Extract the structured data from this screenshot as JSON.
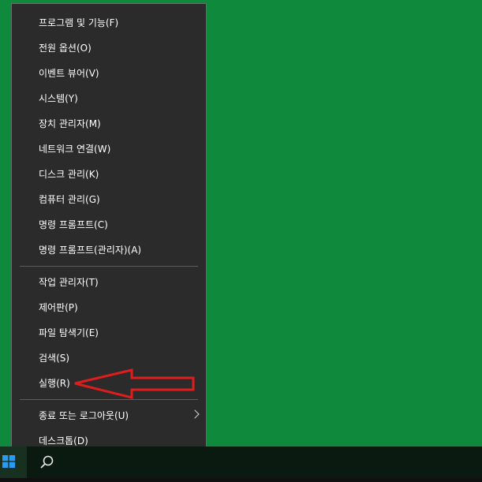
{
  "menu": {
    "items": [
      {
        "label": "프로그램 및 기능(F)"
      },
      {
        "label": "전원 옵션(O)"
      },
      {
        "label": "이벤트 뷰어(V)"
      },
      {
        "label": "시스템(Y)"
      },
      {
        "label": "장치 관리자(M)"
      },
      {
        "label": "네트워크 연결(W)"
      },
      {
        "label": "디스크 관리(K)"
      },
      {
        "label": "컴퓨터 관리(G)"
      },
      {
        "label": "명령 프롬프트(C)"
      },
      {
        "label": "명령 프롬프트(관리자)(A)"
      },
      {
        "label": "작업 관리자(T)"
      },
      {
        "label": "제어판(P)"
      },
      {
        "label": "파일 탐색기(E)"
      },
      {
        "label": "검색(S)"
      },
      {
        "label": "실행(R)"
      },
      {
        "label": "종료 또는 로그아웃(U)"
      },
      {
        "label": "데스크톱(D)"
      }
    ]
  },
  "colors": {
    "desktop_bg": "#0f8a3d",
    "menu_bg": "#2b2b2b",
    "annotation_arrow": "#e01d1d",
    "start_icon": "#2b9af3"
  },
  "icons": {
    "start": "windows-logo-icon",
    "search": "magnifier-icon",
    "submenu": "chevron-right-icon",
    "annotation": "red-outline-arrow-icon"
  }
}
